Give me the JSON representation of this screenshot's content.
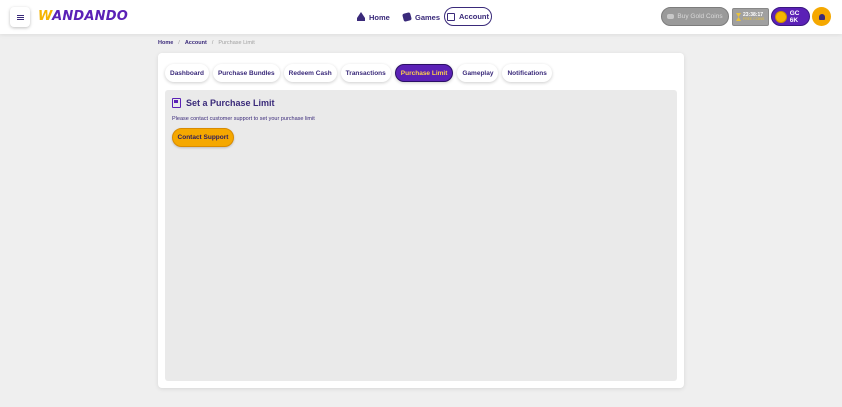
{
  "header": {
    "logo_text": "WANDANDO",
    "nav": [
      {
        "label": "Home",
        "icon": "crown-icon"
      },
      {
        "label": "Games",
        "icon": "games-icon"
      },
      {
        "label": "Account",
        "icon": "account-card-icon"
      }
    ],
    "buy_coins_label": "Buy Gold Coins",
    "timer_value": "23:38:17",
    "timer_sub": "FREE COINS",
    "gc_balance": "GC 6K"
  },
  "breadcrumb": {
    "items": [
      "Home",
      "Account",
      "Purchase Limit"
    ],
    "separator": "/"
  },
  "tabs": [
    {
      "label": "Dashboard",
      "active": false
    },
    {
      "label": "Purchase Bundles",
      "active": false
    },
    {
      "label": "Redeem Cash",
      "active": false
    },
    {
      "label": "Transactions",
      "active": false
    },
    {
      "label": "Purchase Limit",
      "active": true
    },
    {
      "label": "Gameplay",
      "active": false
    },
    {
      "label": "Notifications",
      "active": false
    }
  ],
  "panel": {
    "title": "Set a Purchase Limit",
    "description": "Please contact customer support to set your purchase limit",
    "button_label": "Contact Support"
  },
  "colors": {
    "brand_purple": "#5b21b6",
    "accent_gold": "#f5a800",
    "text_dark": "#3a2a7a"
  }
}
